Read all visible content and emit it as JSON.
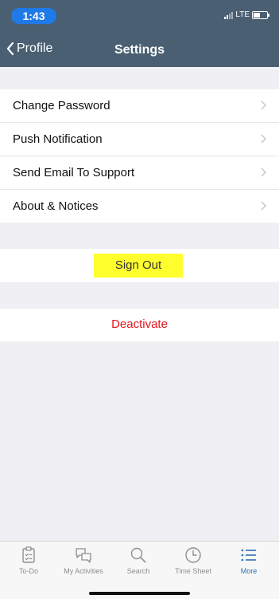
{
  "status_bar": {
    "time": "1:43",
    "network": "LTE"
  },
  "nav": {
    "back_label": "Profile",
    "title": "Settings"
  },
  "settings_rows": [
    {
      "label": "Change Password"
    },
    {
      "label": "Push Notification"
    },
    {
      "label": "Send Email To Support"
    },
    {
      "label": "About & Notices"
    }
  ],
  "actions": {
    "sign_out": "Sign Out",
    "deactivate": "Deactivate"
  },
  "tab_bar": {
    "tabs": [
      {
        "label": "To-Do",
        "icon": "clipboard-icon"
      },
      {
        "label": "My Activities",
        "icon": "chat-bubbles-icon"
      },
      {
        "label": "Search",
        "icon": "search-icon"
      },
      {
        "label": "Time Sheet",
        "icon": "clock-icon"
      },
      {
        "label": "More",
        "icon": "list-icon"
      }
    ],
    "active_tab": "More"
  },
  "colors": {
    "header_bg": "#4a6072",
    "time_pill": "#1f7ae8",
    "sign_out_highlight": "#ffff2e",
    "deactivate_text": "#e8131a",
    "active_tab": "#2e6fb0",
    "inactive_tab": "#8e8e93",
    "page_bg": "#efeff4"
  }
}
